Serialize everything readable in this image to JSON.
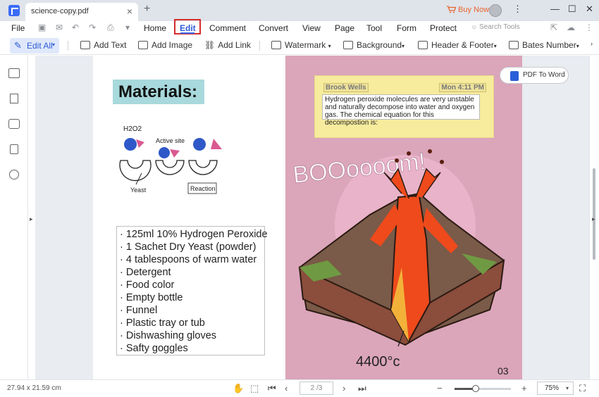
{
  "tab": {
    "filename": "science-copy.pdf"
  },
  "header": {
    "buy_now": "Buy Now"
  },
  "menu": {
    "file": "File",
    "items": [
      "Home",
      "Edit",
      "Comment",
      "Convert",
      "View",
      "Page",
      "Tool",
      "Form",
      "Protect"
    ],
    "search_placeholder": "Search Tools"
  },
  "toolbar": {
    "edit_all": "Edit All",
    "add_text": "Add Text",
    "add_image": "Add Image",
    "add_link": "Add Link",
    "watermark": "Watermark",
    "background": "Background",
    "header_footer": "Header & Footer",
    "bates_number": "Bates Number"
  },
  "document": {
    "materials_title": "Materials:",
    "diagram": {
      "h2o2": "H2O2",
      "active_site": "Active site",
      "yeast": "Yeast",
      "reaction": "Reaction"
    },
    "materials_list": [
      "· 125ml 10% Hydrogen Peroxide",
      "· 1 Sachet Dry Yeast (powder)",
      "· 4 tablespoons of warm water",
      "· Detergent",
      "· Food color",
      "· Empty bottle",
      "· Funnel",
      "· Plastic tray or tub",
      "· Dishwashing gloves",
      "· Safty goggles"
    ],
    "note": {
      "author": "Brook Wells",
      "time": "Mon 4:11 PM",
      "text": "Hydrogen peroxide molecules are very unstable and naturally decompose into water and oxygen gas. The chemical equation for this decompostion is:"
    },
    "boom_text": "BOOoooom!",
    "temperature": "4400°c",
    "page_number": "03"
  },
  "pdf_to_word": "PDF To Word",
  "status": {
    "page_size": "27.94 x 21.59 cm",
    "page_indicator": "2 /3",
    "zoom": "75%",
    "zoom_level": 0.38
  }
}
